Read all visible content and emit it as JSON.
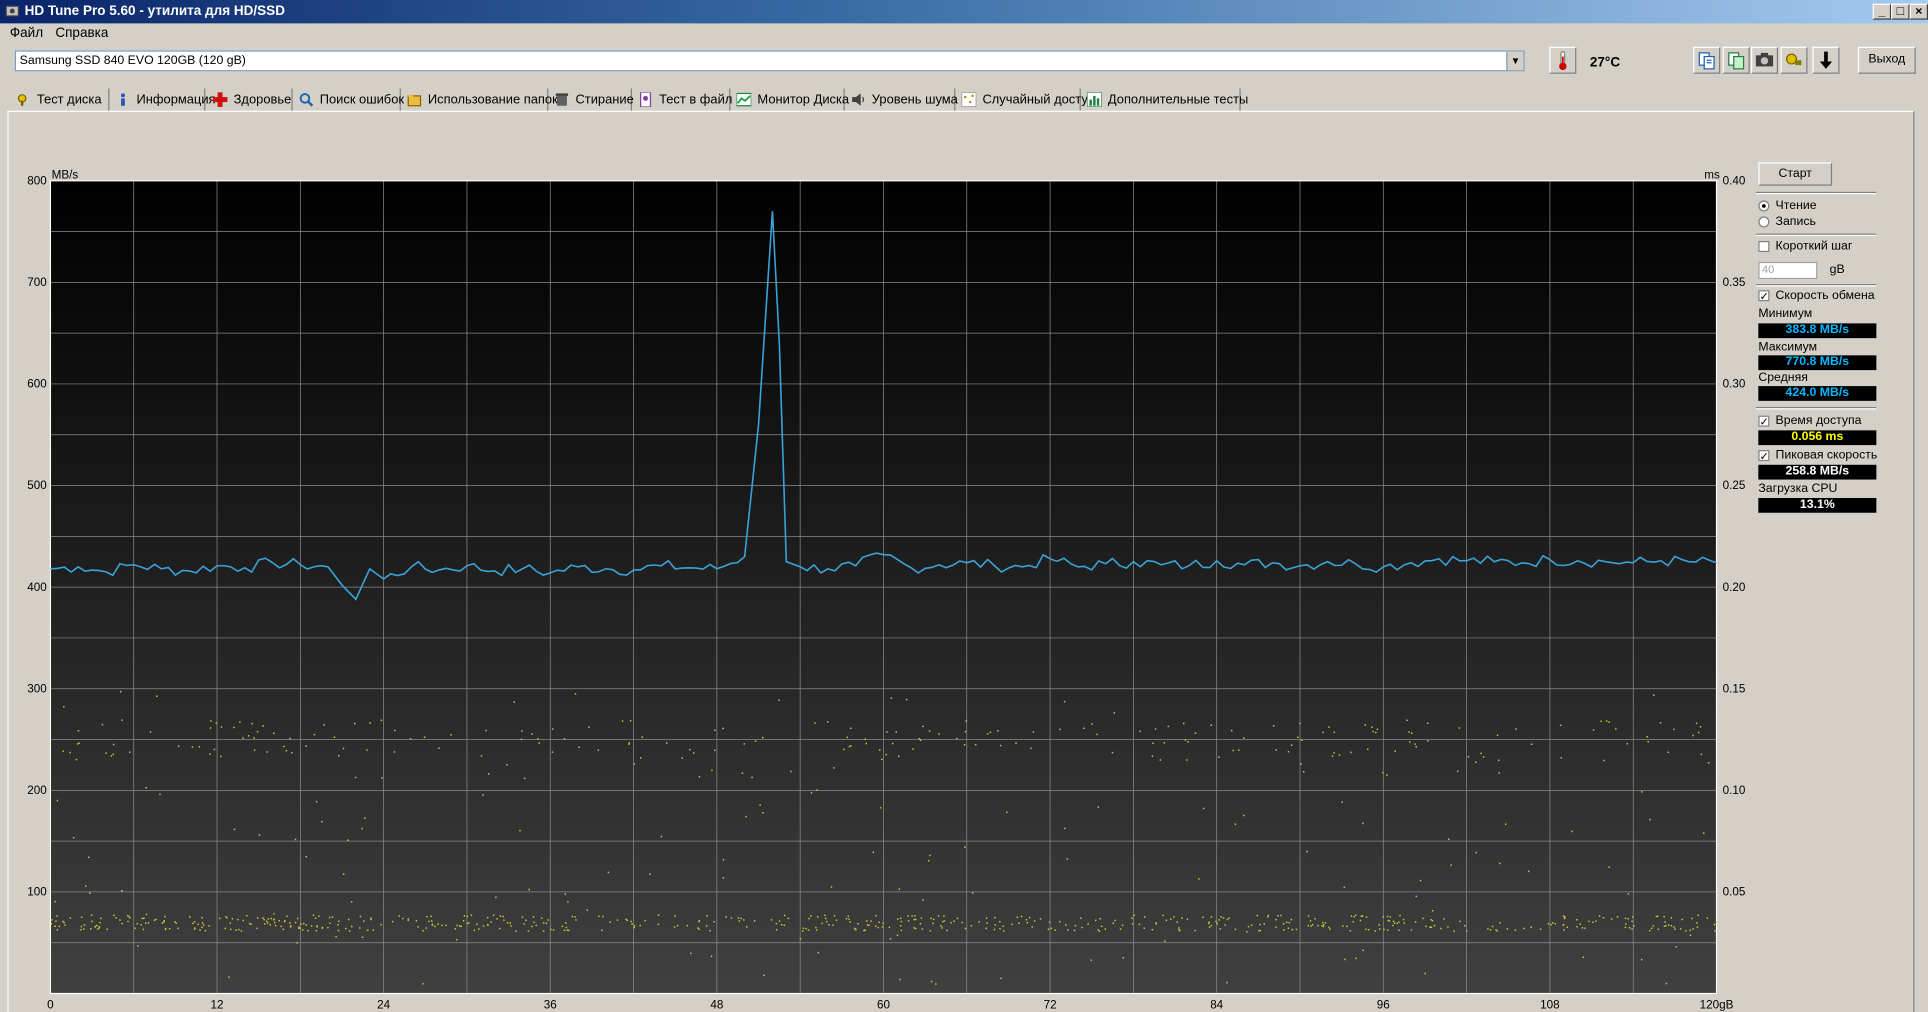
{
  "window": {
    "title": "HD Tune Pro 5.60 - утилита для HD/SSD",
    "controls": [
      "_",
      "□",
      "×"
    ]
  },
  "menu": [
    {
      "label": "Файл"
    },
    {
      "label": "Справка"
    }
  ],
  "toolbar": {
    "drive": "Samsung SSD 840 EVO 120GB (120 gB)",
    "temperature": "27°C",
    "exit_label": "Выход",
    "icons": [
      "thermometer-icon",
      "copy-text-icon",
      "copy-image-icon",
      "camera-icon",
      "options-icon",
      "save-icon"
    ]
  },
  "tabs": [
    {
      "label": "Тест диска",
      "icon": "disk-test-icon",
      "active": true
    },
    {
      "label": "Информация",
      "icon": "info-icon"
    },
    {
      "label": "Здоровье",
      "icon": "health-icon"
    },
    {
      "label": "Поиск ошибок",
      "icon": "search-icon"
    },
    {
      "label": "Использование папок",
      "icon": "folder-icon"
    },
    {
      "label": "Стирание",
      "icon": "erase-icon"
    },
    {
      "label": "Тест в файл",
      "icon": "file-test-icon"
    },
    {
      "label": "Монитор Диска",
      "icon": "monitor-icon"
    },
    {
      "label": "Уровень шума",
      "icon": "noise-icon"
    },
    {
      "label": "Случайный доступ",
      "icon": "random-access-icon"
    },
    {
      "label": "Дополнительные  тесты",
      "icon": "extra-tests-icon"
    }
  ],
  "controls": {
    "start_label": "Старт",
    "read_label": "Чтение",
    "write_label": "Запись",
    "mode": "read",
    "short_step_label": "Короткий шаг",
    "short_step_checked": false,
    "short_step_value": "40",
    "short_step_unit": "gB",
    "transfer_rate_label": "Скорость обмена",
    "transfer_rate_checked": true,
    "min_label": "Минимум",
    "min_value": "383.8 MB/s",
    "max_label": "Максимум",
    "max_value": "770.8 MB/s",
    "avg_label": "Средняя",
    "avg_value": "424.0 MB/s",
    "access_time_label": "Время доступа",
    "access_time_checked": true,
    "access_time_value": "0.056 ms",
    "burst_rate_label": "Пиковая скорость",
    "burst_rate_checked": true,
    "burst_rate_value": "258.8 MB/s",
    "cpu_label": "Загрузка CPU",
    "cpu_value": "13.1%",
    "colors": {
      "value_blue": "#00b7ff",
      "value_yellow": "#ffff00"
    }
  },
  "chart_data": {
    "type": "line",
    "y_left_unit": "MB/s",
    "y_right_unit": "ms",
    "x_unit": "gB",
    "x_ticks": [
      "0",
      "12",
      "24",
      "36",
      "48",
      "60",
      "72",
      "84",
      "96",
      "108",
      "120gB"
    ],
    "y_left_ticks": [
      "800",
      "700",
      "600",
      "500",
      "400",
      "300",
      "200",
      "100"
    ],
    "y_right_ticks": [
      "0.40",
      "0.35",
      "0.30",
      "0.25",
      "0.20",
      "0.15",
      "0.10",
      "0.05"
    ],
    "xlim": [
      0,
      120
    ],
    "ylim_left": [
      0,
      800
    ],
    "ylim_right": [
      0,
      0.4
    ],
    "grid": true,
    "series": [
      {
        "name": "Скорость обмена",
        "color": "#3ba2d8",
        "x": [
          0,
          2,
          4,
          6,
          8,
          10,
          12,
          14,
          16,
          18,
          20,
          21,
          22,
          23,
          24,
          26,
          28,
          30,
          32,
          34,
          36,
          38,
          40,
          42,
          44,
          46,
          48,
          50,
          51,
          52,
          52.5,
          53,
          54,
          56,
          58,
          60,
          62,
          64,
          66,
          68,
          70,
          72,
          74,
          76,
          78,
          80,
          82,
          84,
          86,
          88,
          90,
          92,
          94,
          96,
          98,
          100,
          102,
          104,
          106,
          108,
          110,
          112,
          114,
          116,
          118,
          120
        ],
        "y": [
          418,
          420,
          415,
          422,
          418,
          416,
          421,
          419,
          424,
          422,
          420,
          402,
          388,
          418,
          408,
          420,
          417,
          421,
          416,
          418,
          414,
          420,
          418,
          417,
          421,
          419,
          418,
          430,
          560,
          770,
          640,
          425,
          420,
          418,
          421,
          432,
          419,
          422,
          424,
          421,
          420,
          428,
          420,
          423,
          425,
          422,
          421,
          426,
          422,
          424,
          421,
          425,
          423,
          420,
          424,
          428,
          426,
          425,
          424,
          427,
          426,
          425,
          424,
          426,
          425,
          424
        ]
      },
      {
        "name": "Время доступа",
        "type": "scatter",
        "color": "#c8c832",
        "value_range_ms": [
          0.025,
          0.15
        ],
        "typical_ms": 0.035
      }
    ]
  }
}
